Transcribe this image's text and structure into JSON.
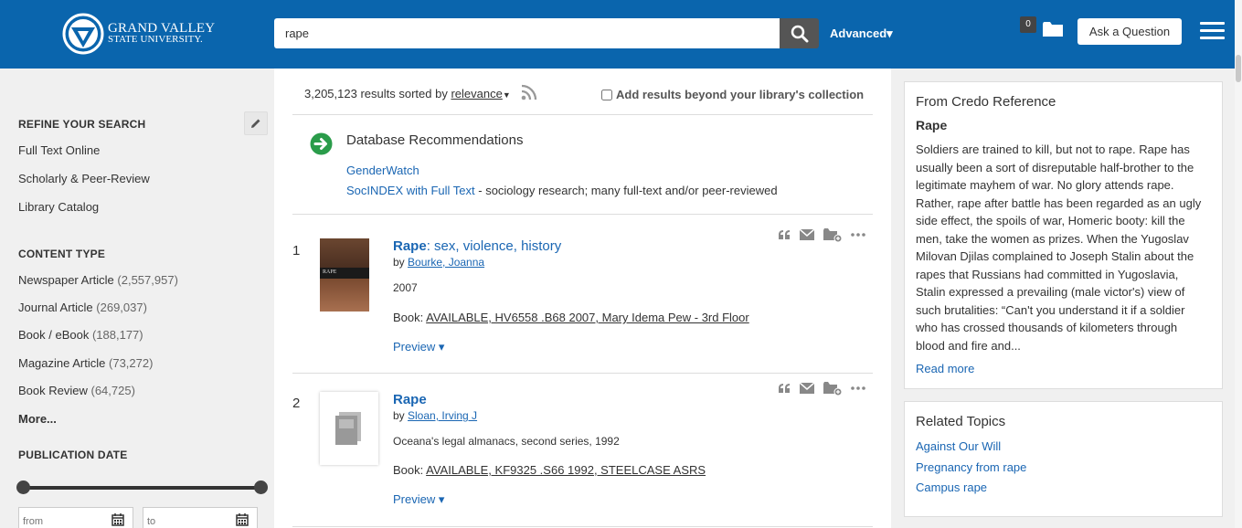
{
  "header": {
    "logo_line1": "GRAND VALLEY",
    "logo_line2": "STATE UNIVERSITY.",
    "search_value": "rape",
    "advanced_label": "Advanced▾",
    "folder_count": "0",
    "ask_label": "Ask a Question"
  },
  "sidebar": {
    "refine_heading": "REFINE YOUR SEARCH",
    "refine_items": [
      "Full Text Online",
      "Scholarly & Peer-Review",
      "Library Catalog"
    ],
    "content_type_heading": "CONTENT TYPE",
    "content_types": [
      {
        "label": "Newspaper Article",
        "count": "(2,557,957)"
      },
      {
        "label": "Journal Article",
        "count": "(269,037)"
      },
      {
        "label": "Book / eBook",
        "count": "(188,177)"
      },
      {
        "label": "Magazine Article",
        "count": "(73,272)"
      },
      {
        "label": "Book Review",
        "count": "(64,725)"
      }
    ],
    "more_label": "More...",
    "pub_date_heading": "PUBLICATION DATE",
    "from_placeholder": "from",
    "to_placeholder": "to"
  },
  "main": {
    "results_text": "3,205,123 results sorted by",
    "sort_label": "relevance",
    "beyond_label": "Add results beyond your library's collection",
    "db_title": "Database Recommendations",
    "db_link1": "GenderWatch",
    "db_link2": "SocINDEX with Full Text",
    "db_link2_desc": " - sociology research; many full-text and/or peer-reviewed",
    "results": [
      {
        "num": "1",
        "title_bold": "Rape",
        "title_rest": ": sex, violence, history",
        "by": "by ",
        "author": "Bourke, Joanna",
        "meta": "2007",
        "avail_prefix": "Book: ",
        "avail": "AVAILABLE, HV6558 .B68 2007, Mary Idema Pew - 3rd Floor",
        "preview": "Preview ▾",
        "thumb_text": "RAPE"
      },
      {
        "num": "2",
        "title_bold": "Rape",
        "title_rest": "",
        "by": "by ",
        "author": "Sloan, Irving J",
        "meta": "Oceana's legal almanacs, second series, 1992",
        "avail_prefix": "Book: ",
        "avail": "AVAILABLE, KF9325 .S66 1992, STEELCASE ASRS",
        "preview": "Preview ▾"
      }
    ]
  },
  "credo": {
    "heading": "From Credo Reference",
    "subtitle": "Rape",
    "body": "Soldiers are trained to kill, but not to rape. Rape has usually been a sort of disreputable half-brother to the legitimate mayhem of war. No glory attends rape. Rather, rape after battle has been regarded as an ugly side effect, the spoils of war, Homeric booty: kill the men, take the women as prizes. When the Yugoslav Milovan Djilas complained to Joseph Stalin about the rapes that Russians had committed in Yugoslavia, Stalin expressed a prevailing (male victor's) view of such brutalities: “Can't you understand it if a soldier who has crossed thousands of kilometers through blood and fire and...",
    "read_more": "Read more"
  },
  "related": {
    "heading": "Related Topics",
    "links": [
      "Against Our Will",
      "Pregnancy from rape",
      "Campus rape"
    ]
  }
}
